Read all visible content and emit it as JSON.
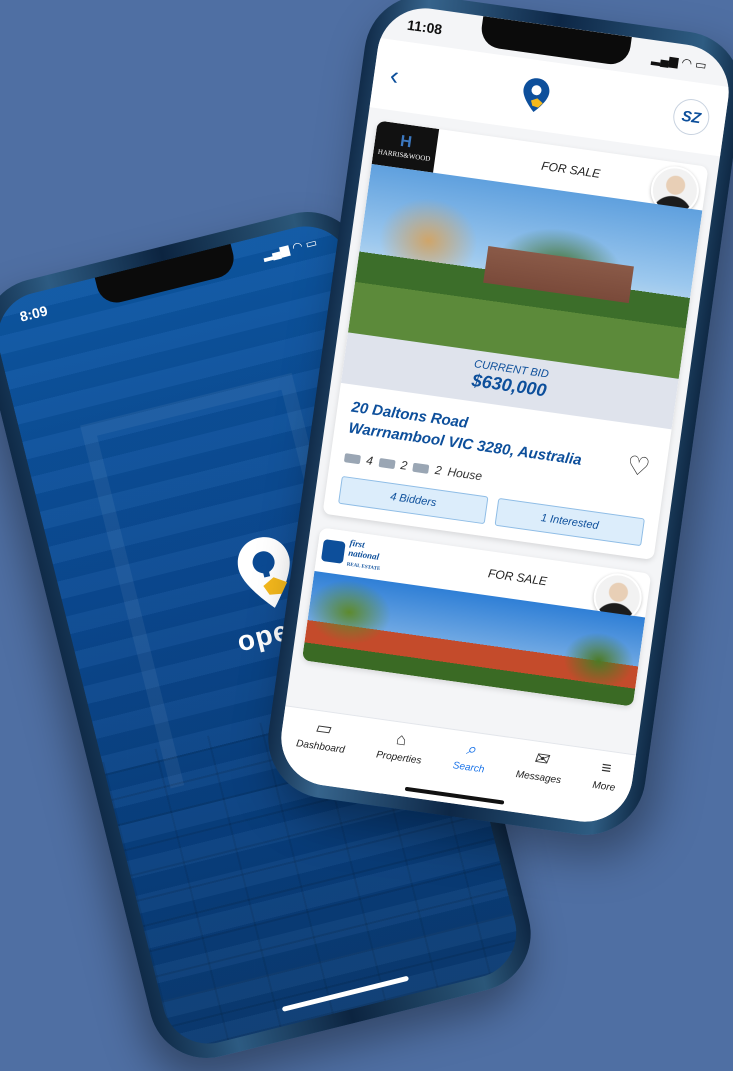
{
  "back_phone": {
    "time": "8:09",
    "status_icons": "▂▄▆ ◠ ▭",
    "brand_text_a": "open",
    "brand_text_b": "n"
  },
  "front_phone": {
    "time": "11:08",
    "status_icons": "▂▄▆ ◠ ▭",
    "header": {
      "back_icon": "chevron-left-icon",
      "back_glyph": "‹",
      "user_initials": "SZ"
    },
    "listings": [
      {
        "agency": "HARRIS&WOOD",
        "agency_mark": "H",
        "status": "FOR SALE",
        "bid_label": "CURRENT BID",
        "bid_value": "$630,000",
        "address_line1": "20 Daltons Road",
        "address_line2": "Warrnambool VIC 3280, Australia",
        "beds": "4",
        "baths": "2",
        "cars": "2",
        "property_type": "House",
        "bidders_label": "4 Bidders",
        "interested_label": "1 Interested"
      },
      {
        "agency_line1": "first",
        "agency_line2": "national",
        "agency_line3": "REAL ESTATE",
        "status": "FOR SALE"
      }
    ],
    "tabs": [
      {
        "label": "Dashboard",
        "glyph": "▭"
      },
      {
        "label": "Properties",
        "glyph": "⌂"
      },
      {
        "label": "Search",
        "glyph": "⌕"
      },
      {
        "label": "Messages",
        "glyph": "✉"
      },
      {
        "label": "More",
        "glyph": "≡"
      }
    ]
  },
  "colors": {
    "background": "#4f6fa3",
    "brand_blue": "#0d4f9b",
    "brand_yellow": "#f4b81c",
    "active_tab": "#1a73e8"
  }
}
